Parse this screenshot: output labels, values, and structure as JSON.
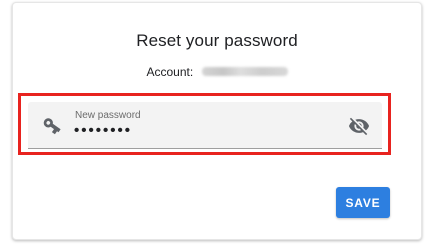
{
  "dialog": {
    "title": "Reset your password",
    "account_label": "Account:",
    "account_value_redacted": true
  },
  "password_field": {
    "label": "New password",
    "value": "••••••••",
    "leading_icon": "key-icon",
    "trailing_icon": "visibility-off-icon"
  },
  "actions": {
    "save_label": "SAVE"
  },
  "colors": {
    "highlight_border": "#e8231f",
    "save_button": "#2d7fe0",
    "field_background": "#f3f3f3",
    "icon": "#5f6368"
  }
}
